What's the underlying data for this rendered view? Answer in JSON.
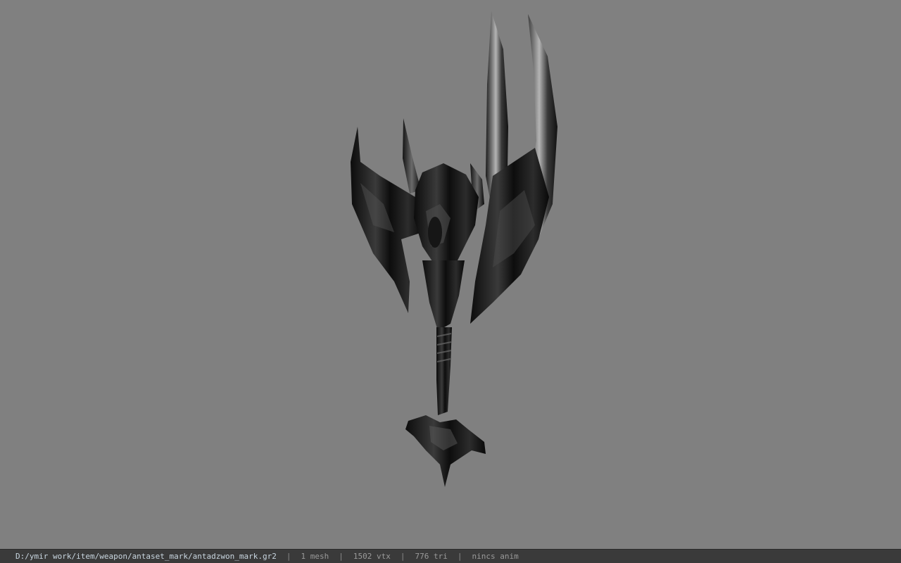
{
  "viewport": {
    "background": "#808080",
    "model_name": "antadzwon_mark"
  },
  "status": {
    "path": "D:/ymir work/item/weapon/antaset_mark/antadzwon_mark.gr2",
    "separator": "|",
    "mesh_count": "1 mesh",
    "vertex_count": "1502 vtx",
    "triangle_count": "776 tri",
    "animation": "nincs anim"
  }
}
